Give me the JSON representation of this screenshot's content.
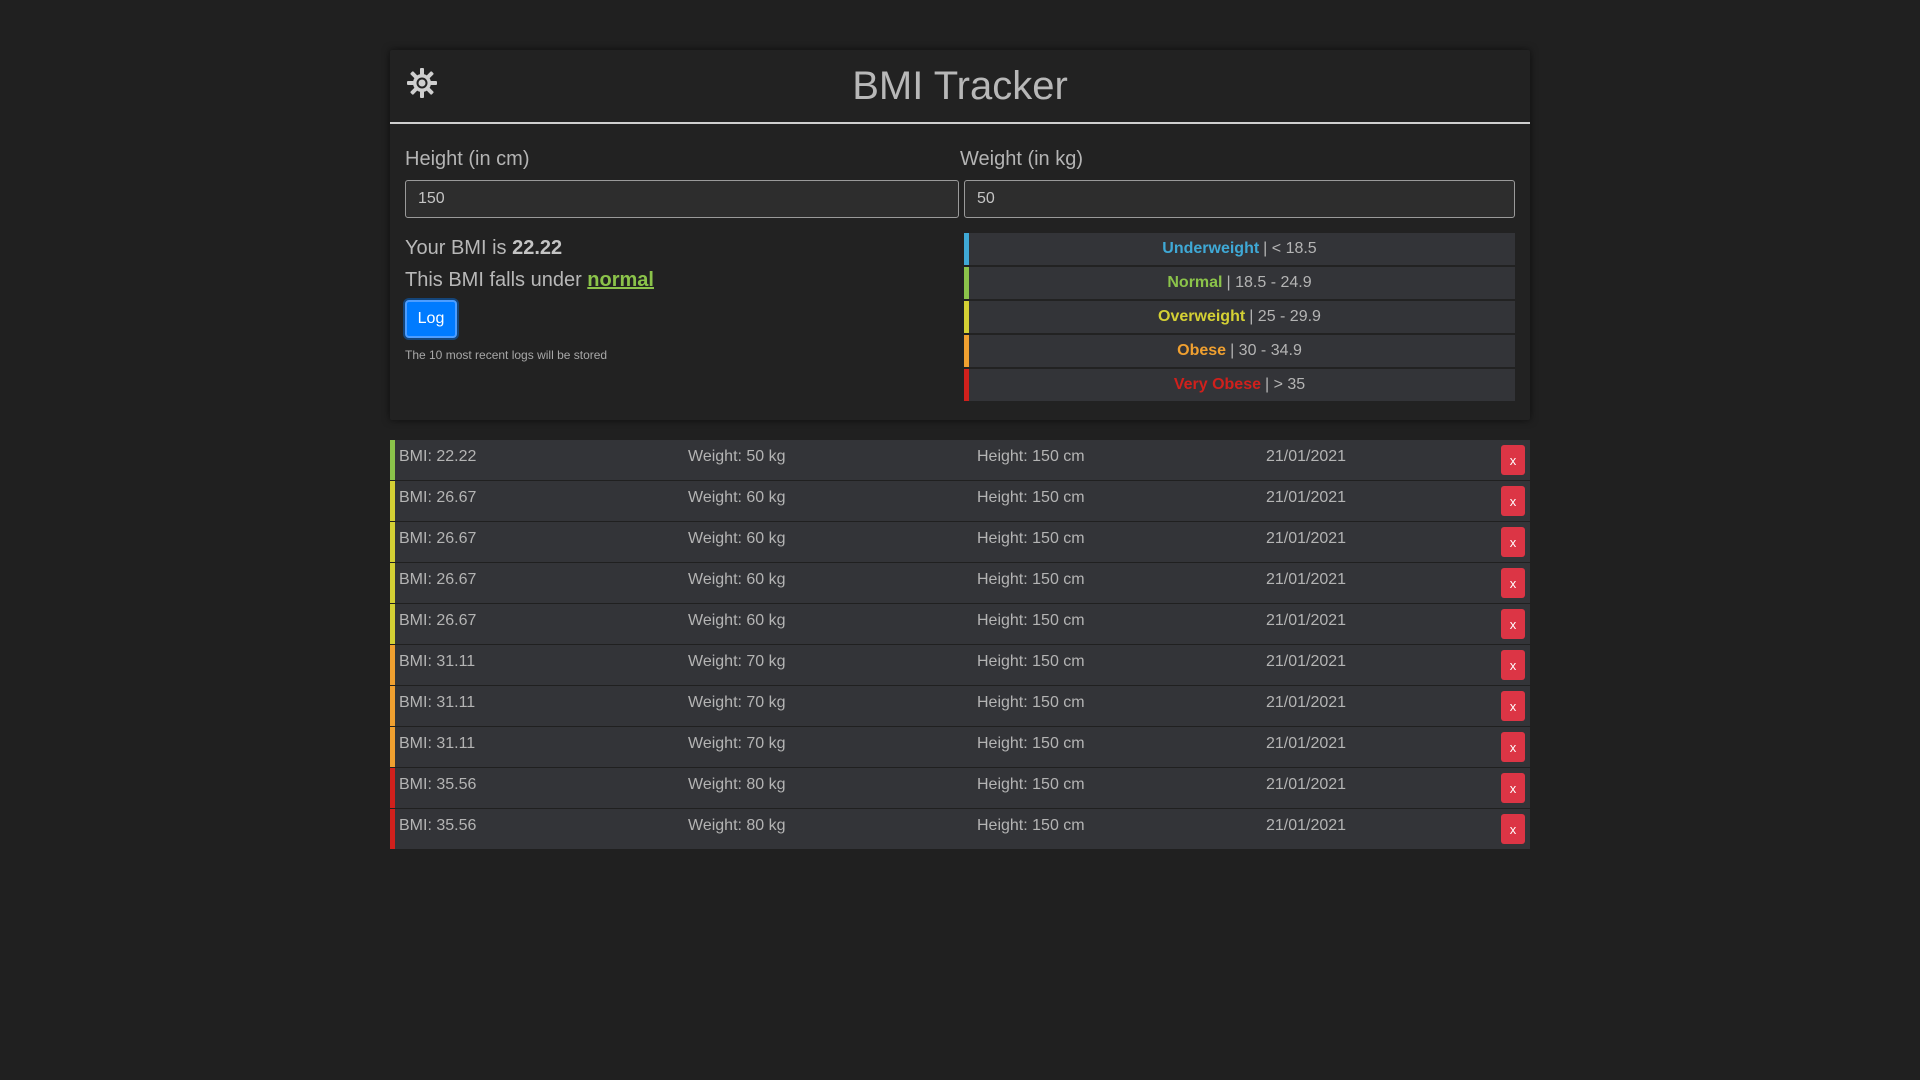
{
  "header": {
    "title": "BMI Tracker",
    "theme_icon": "gear-icon"
  },
  "form": {
    "height_label": "Height (in cm)",
    "height_value": "150",
    "weight_label": "Weight (in kg)",
    "weight_value": "50"
  },
  "result": {
    "bmi_prefix": "Your BMI is ",
    "bmi_value": "22.22",
    "category_prefix": "This BMI falls under ",
    "category": "normal",
    "category_color": "#8bc34a",
    "log_label": "Log",
    "note": "The 10 most recent logs will be stored"
  },
  "legend": [
    {
      "name": "Underweight",
      "range": "| < 18.5",
      "color": "#3fa9d6"
    },
    {
      "name": "Normal",
      "range": "| 18.5 - 24.9",
      "color": "#8bc34a"
    },
    {
      "name": "Overweight",
      "range": "| 25 - 29.9",
      "color": "#d4d034"
    },
    {
      "name": "Obese",
      "range": "| 30 - 34.9",
      "color": "#f0a030"
    },
    {
      "name": "Very Obese",
      "range": "| > 35",
      "color": "#d0201c"
    }
  ],
  "logs": [
    {
      "bmi": "BMI: 22.22",
      "weight": "Weight: 50 kg",
      "height": "Height: 150 cm",
      "date": "21/01/2021",
      "color": "#8bc34a",
      "delete_label": "x"
    },
    {
      "bmi": "BMI: 26.67",
      "weight": "Weight: 60 kg",
      "height": "Height: 150 cm",
      "date": "21/01/2021",
      "color": "#d4d034",
      "delete_label": "x"
    },
    {
      "bmi": "BMI: 26.67",
      "weight": "Weight: 60 kg",
      "height": "Height: 150 cm",
      "date": "21/01/2021",
      "color": "#d4d034",
      "delete_label": "x"
    },
    {
      "bmi": "BMI: 26.67",
      "weight": "Weight: 60 kg",
      "height": "Height: 150 cm",
      "date": "21/01/2021",
      "color": "#d4d034",
      "delete_label": "x"
    },
    {
      "bmi": "BMI: 26.67",
      "weight": "Weight: 60 kg",
      "height": "Height: 150 cm",
      "date": "21/01/2021",
      "color": "#d4d034",
      "delete_label": "x"
    },
    {
      "bmi": "BMI: 31.11",
      "weight": "Weight: 70 kg",
      "height": "Height: 150 cm",
      "date": "21/01/2021",
      "color": "#f0a030",
      "delete_label": "x"
    },
    {
      "bmi": "BMI: 31.11",
      "weight": "Weight: 70 kg",
      "height": "Height: 150 cm",
      "date": "21/01/2021",
      "color": "#f0a030",
      "delete_label": "x"
    },
    {
      "bmi": "BMI: 31.11",
      "weight": "Weight: 70 kg",
      "height": "Height: 150 cm",
      "date": "21/01/2021",
      "color": "#f0a030",
      "delete_label": "x"
    },
    {
      "bmi": "BMI: 35.56",
      "weight": "Weight: 80 kg",
      "height": "Height: 150 cm",
      "date": "21/01/2021",
      "color": "#d0201c",
      "delete_label": "x"
    },
    {
      "bmi": "BMI: 35.56",
      "weight": "Weight: 80 kg",
      "height": "Height: 150 cm",
      "date": "21/01/2021",
      "color": "#d0201c",
      "delete_label": "x"
    }
  ]
}
